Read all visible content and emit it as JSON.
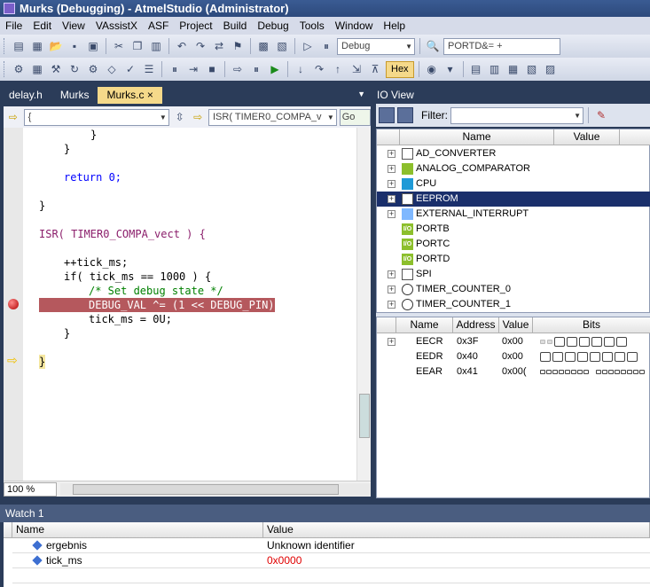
{
  "window": {
    "title": "Murks (Debugging) - AtmelStudio (Administrator)"
  },
  "menu": [
    "File",
    "Edit",
    "View",
    "VAssistX",
    "ASF",
    "Project",
    "Build",
    "Debug",
    "Tools",
    "Window",
    "Help"
  ],
  "toolbar": {
    "config": "Debug",
    "find_text": "PORTD&= +",
    "hex_label": "Hex"
  },
  "tabs": [
    {
      "label": "delay.h"
    },
    {
      "label": "Murks"
    },
    {
      "label": "Murks.c",
      "close": "×"
    }
  ],
  "editor": {
    "nav_scope": "{",
    "nav_function": "ISR( TIMER0_COMPA_v",
    "go_label": "Go",
    "zoom": "100 %",
    "lines": [
      "}",
      "}",
      "",
      "return 0;",
      "",
      "}",
      "",
      "ISR( TIMER0_COMPA_vect ) {",
      "",
      "++tick_ms;",
      "if( tick_ms == 1000 ) {",
      "/* Set debug state */",
      "DEBUG_VAL ^= (1 << DEBUG_PIN);",
      "tick_ms = 0U;",
      "}",
      "",
      "}"
    ]
  },
  "io_view": {
    "title": "IO View",
    "filter_label": "Filter:",
    "tree_headers": {
      "name": "Name",
      "value": "Value"
    },
    "modules": [
      {
        "name": "AD_CONVERTER",
        "icon": "doc-icon",
        "expand": "+"
      },
      {
        "name": "ANALOG_COMPARATOR",
        "icon": "adc-icon",
        "expand": "+"
      },
      {
        "name": "CPU",
        "icon": "chip-icon",
        "expand": "+"
      },
      {
        "name": "EEPROM",
        "icon": "doc-icon",
        "expand": "+"
      },
      {
        "name": "EXTERNAL_INTERRUPT",
        "icon": "interrupt-icon",
        "expand": "+"
      },
      {
        "name": "PORTB",
        "icon": "io-icon",
        "io": "I/O"
      },
      {
        "name": "PORTC",
        "icon": "io-icon",
        "io": "I/O"
      },
      {
        "name": "PORTD",
        "icon": "io-icon",
        "io": "I/O"
      },
      {
        "name": "SPI",
        "icon": "doc-icon",
        "expand": "+"
      },
      {
        "name": "TIMER_COUNTER_0",
        "icon": "clock-icon",
        "expand": "+"
      },
      {
        "name": "TIMER_COUNTER_1",
        "icon": "clock-icon",
        "expand": "+"
      }
    ],
    "grid_headers": {
      "name": "Name",
      "address": "Address",
      "value": "Value",
      "bits": "Bits"
    },
    "registers": [
      {
        "name": "EECR",
        "address": "0x3F",
        "value": "0x00",
        "expand": "+"
      },
      {
        "name": "EEDR",
        "address": "0x40",
        "value": "0x00"
      },
      {
        "name": "EEAR",
        "address": "0x41",
        "value": "0x00("
      }
    ]
  },
  "watch": {
    "title": "Watch 1",
    "headers": {
      "name": "Name",
      "value": "Value"
    },
    "rows": [
      {
        "name": "ergebnis",
        "value": "Unknown identifier"
      },
      {
        "name": "tick_ms",
        "value": "0x0000"
      }
    ]
  },
  "colors": {
    "accent_tab": "#f5d98a",
    "breakpoint_line": "#b5585d",
    "selection": "#1a2f6b",
    "frame": "#2b3c59"
  }
}
